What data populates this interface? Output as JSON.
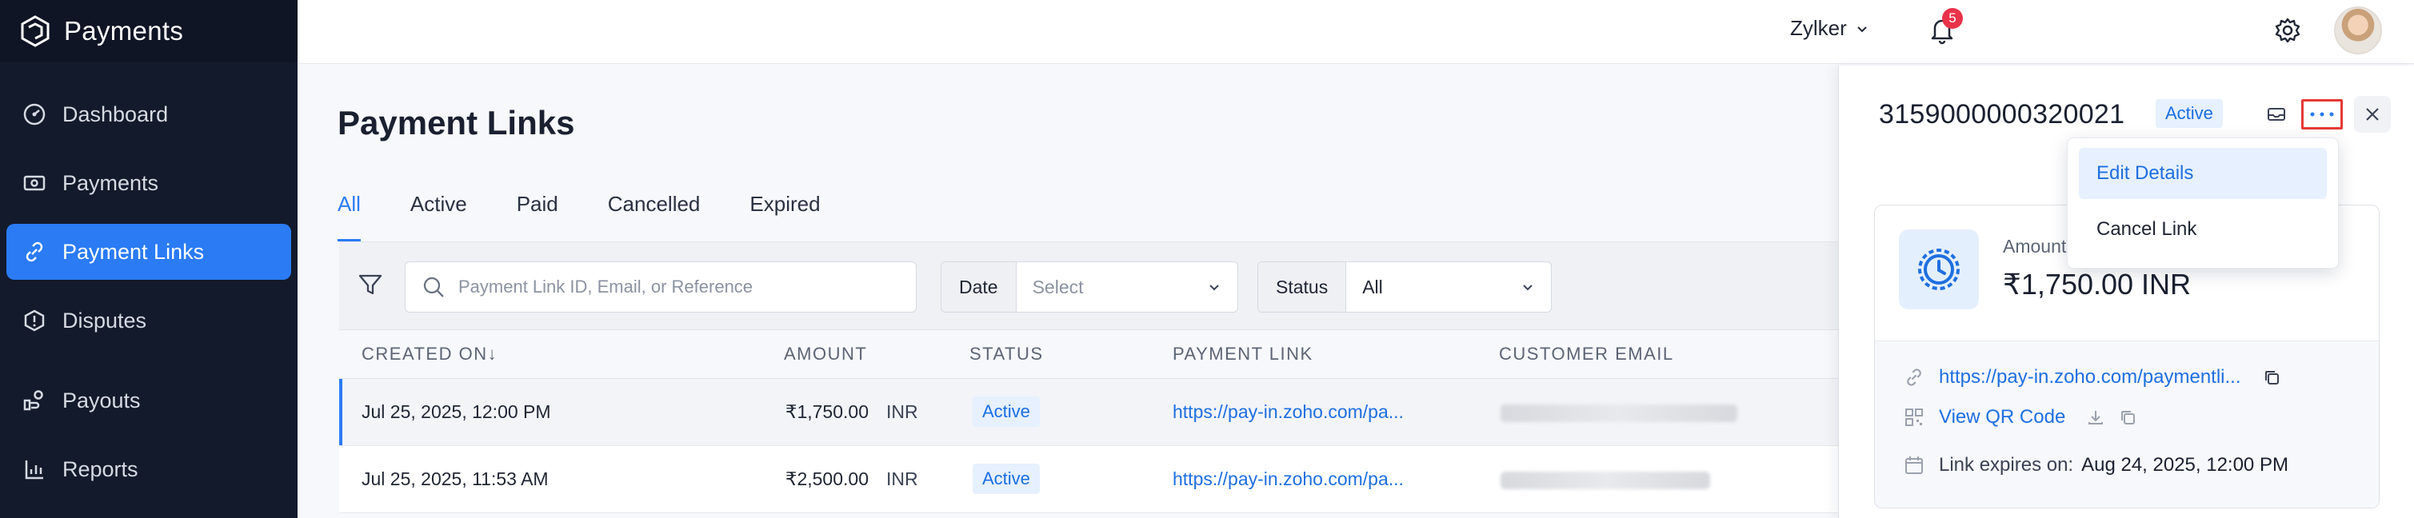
{
  "app": {
    "name": "Payments"
  },
  "sidebar": {
    "items": [
      {
        "label": "Dashboard",
        "icon": "dashboard-icon",
        "active": false
      },
      {
        "label": "Payments",
        "icon": "payments-icon",
        "active": false
      },
      {
        "label": "Payment Links",
        "icon": "link-icon",
        "active": true
      },
      {
        "label": "Disputes",
        "icon": "dispute-icon",
        "active": false
      },
      {
        "label": "Payouts",
        "icon": "payouts-icon",
        "active": false
      },
      {
        "label": "Reports",
        "icon": "reports-icon",
        "active": false
      }
    ]
  },
  "topbar": {
    "org_name": "Zylker",
    "notification_count": "5"
  },
  "main": {
    "title": "Payment Links",
    "tabs": [
      "All",
      "Active",
      "Paid",
      "Cancelled",
      "Expired"
    ],
    "active_tab": "All",
    "filters": {
      "search_placeholder": "Payment Link ID, Email, or Reference",
      "date_label": "Date",
      "date_value": "Select",
      "status_label": "Status",
      "status_value": "All"
    },
    "table": {
      "headers": {
        "created_on": "CREATED ON↓",
        "amount": "AMOUNT",
        "status": "STATUS",
        "payment_link": "PAYMENT LINK",
        "customer_email": "CUSTOMER EMAIL"
      },
      "rows": [
        {
          "created_on": "Jul 25, 2025, 12:00 PM",
          "amount": "₹1,750.00",
          "currency": "INR",
          "status": "Active",
          "payment_link": "https://pay-in.zoho.com/pa...",
          "selected": true
        },
        {
          "created_on": "Jul 25, 2025, 11:53 AM",
          "amount": "₹2,500.00",
          "currency": "INR",
          "status": "Active",
          "payment_link": "https://pay-in.zoho.com/pa...",
          "selected": false
        }
      ]
    }
  },
  "detail": {
    "id": "3159000000320021",
    "status": "Active",
    "amount_label": "Amount",
    "amount_value": "₹1,750.00 INR",
    "link_url": "https://pay-in.zoho.com/paymentli...",
    "qr_label": "View QR Code",
    "expires_label": "Link expires on:",
    "expires_value": "Aug 24, 2025, 12:00 PM",
    "menu": {
      "items": [
        {
          "label": "Edit Details",
          "hover": true
        },
        {
          "label": "Cancel Link",
          "hover": false
        }
      ]
    }
  },
  "colors": {
    "accent": "#2a7bf4",
    "sidebar_bg": "#131a2b",
    "badge": "#e8334a",
    "highlight_border": "#e53935"
  }
}
